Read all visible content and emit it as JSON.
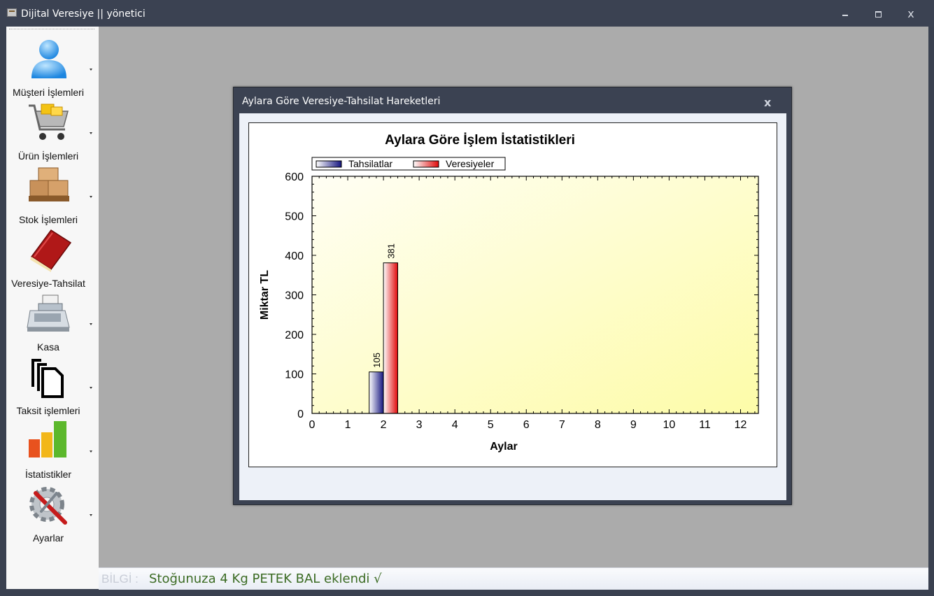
{
  "window": {
    "title": "Dijital Veresiye  ||  yönetici",
    "minimize_glyph": "",
    "close_glyph": "x"
  },
  "sidebar": {
    "items": [
      {
        "label": "Müşteri İşlemleri",
        "icon": "user-icon"
      },
      {
        "label": "Ürün İşlemleri",
        "icon": "shopping-cart-icon"
      },
      {
        "label": "Stok İşlemleri",
        "icon": "boxes-icon"
      },
      {
        "label": "Veresiye-Tahsilat",
        "icon": "book-icon"
      },
      {
        "label": "Kasa",
        "icon": "cash-register-icon"
      },
      {
        "label": "Taksit işlemleri",
        "icon": "documents-icon"
      },
      {
        "label": "İstatistikler",
        "icon": "bar-chart-icon"
      },
      {
        "label": "Ayarlar",
        "icon": "settings-gear-icon"
      }
    ]
  },
  "dialog": {
    "title": "Aylara Göre Veresiye-Tahsilat Hareketleri",
    "close_glyph": "x"
  },
  "status": {
    "prefix": "BİLGİ  :",
    "message": "Stoğunuza 4 Kg PETEK BAL eklendi  √"
  },
  "chart_data": {
    "type": "bar",
    "title": "Aylara Göre İşlem İstatistikleri",
    "xlabel": "Aylar",
    "ylabel": "Miktar TL",
    "xlim": [
      0,
      12.5
    ],
    "ylim": [
      0,
      600
    ],
    "x_ticks": [
      0,
      1,
      2,
      3,
      4,
      5,
      6,
      7,
      8,
      9,
      10,
      11,
      12
    ],
    "y_ticks": [
      0,
      100,
      200,
      300,
      400,
      500,
      600
    ],
    "legend_position": "top-left",
    "series": [
      {
        "name": "Tahsilatlar",
        "color": "#1c1c8c",
        "points": [
          {
            "x": 2,
            "y": 105,
            "label": "105"
          }
        ]
      },
      {
        "name": "Veresiyeler",
        "color": "#e01010",
        "points": [
          {
            "x": 2,
            "y": 381,
            "label": "381"
          }
        ]
      }
    ]
  }
}
